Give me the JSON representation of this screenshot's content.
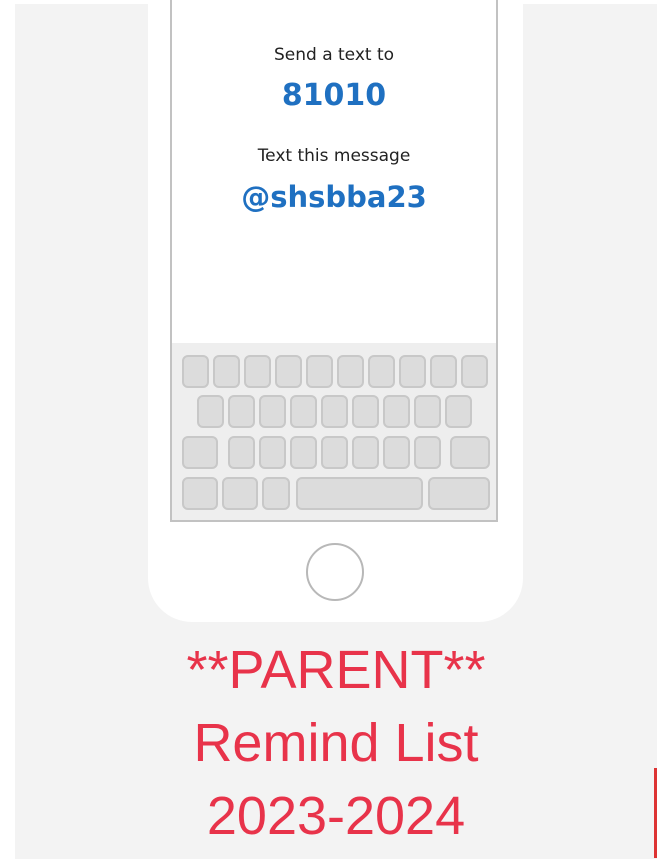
{
  "screen": {
    "send_label": "Send a text to",
    "number": "81010",
    "message_label": "Text this message",
    "code": "@shsbba23"
  },
  "caption": {
    "line1": "**PARENT**",
    "line2": "Remind List",
    "line3": "2023-2024"
  }
}
